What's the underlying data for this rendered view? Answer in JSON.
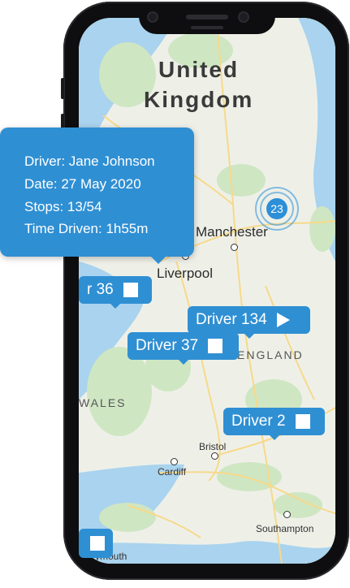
{
  "map": {
    "country": [
      "United",
      "Kingdom"
    ],
    "regions": {
      "england": "ENGLAND",
      "wales": "WALES"
    },
    "cities": {
      "manchester": "Manchester",
      "liverpool": "Liverpool",
      "bristol": "Bristol",
      "cardiff": "Cardiff",
      "southampton": "Southampton",
      "plymouth": "ymouth"
    }
  },
  "cluster": {
    "count": "23"
  },
  "info_card": {
    "driver": "Driver: Jane Johnson",
    "date": "Date: 27 May 2020",
    "stops": "Stops: 13/54",
    "time": "Time Driven: 1h55m"
  },
  "drivers": {
    "d36": {
      "label": "r 36",
      "icon": "stop-icon"
    },
    "d134": {
      "label": "Driver 134",
      "icon": "play-icon"
    },
    "d37": {
      "label": "Driver 37",
      "icon": "stop-icon"
    },
    "d2": {
      "label": "Driver 2",
      "icon": "stop-icon"
    },
    "bottom": {
      "icon": "stop-icon"
    }
  },
  "colors": {
    "accent": "#2f8fd3",
    "water": "#a9d3ee",
    "land": "#eef0e8",
    "green": "#cfe6c3",
    "road": "#f7d98a"
  }
}
